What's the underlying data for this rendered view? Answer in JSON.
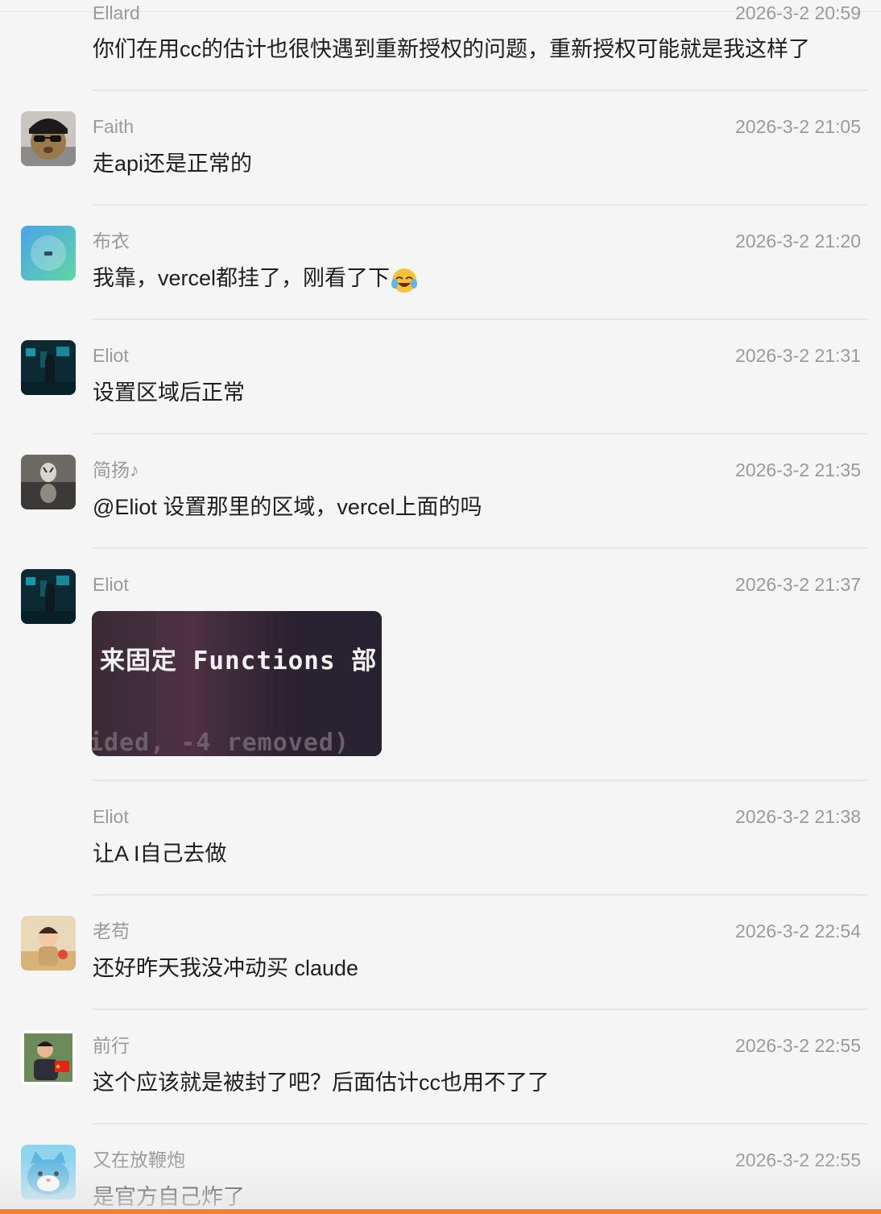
{
  "messages": [
    {
      "name": "Ellard",
      "time": "2026-3-2 20:59",
      "text": "你们在用cc的估计也很快遇到重新授权的问题，重新授权可能就是我这样了"
    },
    {
      "name": "Faith",
      "time": "2026-3-2 21:05",
      "text": "走api还是正常的"
    },
    {
      "name": "布衣",
      "time": "2026-3-2 21:20",
      "text": "我靠，vercel都挂了，刚看了下",
      "emoji": "laughing-crying-emoji"
    },
    {
      "name": "Eliot",
      "time": "2026-3-2 21:31",
      "text": "设置区域后正常"
    },
    {
      "name": "简扬♪",
      "time": "2026-3-2 21:35",
      "text": "@Eliot 设置那里的区域，vercel上面的吗"
    },
    {
      "name": "Eliot",
      "time": "2026-3-2 21:37",
      "image": {
        "line1": "来固定 Functions 部",
        "line2": "ided, -4 removed)"
      }
    },
    {
      "name": "Eliot",
      "time": "2026-3-2 21:38",
      "text": "让A I自己去做"
    },
    {
      "name": "老苟",
      "time": "2026-3-2 22:54",
      "text": "还好昨天我没冲动买 claude"
    },
    {
      "name": "前行",
      "time": "2026-3-2 22:55",
      "text": "这个应该就是被封了吧？后面估计cc也用不了了"
    },
    {
      "name": "又在放鞭炮",
      "time": "2026-3-2 22:55",
      "text": "是官方自己炸了"
    }
  ],
  "colors": {
    "background": "#f5f5f5",
    "meta_text": "#9a9a9a",
    "body_text": "#1e1e1e",
    "divider": "#e6e6e6",
    "bottom_accent": "#e7863a"
  }
}
